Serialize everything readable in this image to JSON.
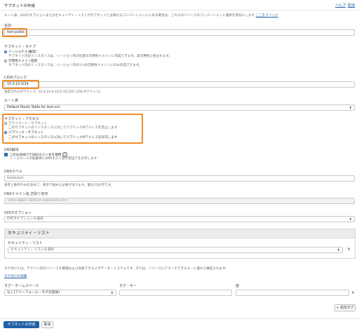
{
  "header": {
    "title": "サブネットの作成",
    "help": "ヘルプ",
    "cancel": "取消"
  },
  "intro": {
    "text": "ルート表、DHCPオプションまたはセキュリティ・リストがサブネットとは異なるコンパートメントにある場合は、これらのリソースのコンパートメント選択を有効にします",
    "link": "ここをクリック"
  },
  "name": {
    "label": "名前",
    "value": "test-public"
  },
  "subnet_type": {
    "label": "サブネット・タイプ",
    "options": [
      {
        "title": "リージョナル(推奨)",
        "desc": "サブネット内のインスタンスは、リージョン内の任意の可用性ドメインに作成できます。高可用性に役立ちます。",
        "selected": true
      },
      {
        "title": "可用性ドメイン固有",
        "desc": "サブネット内のインスタンスは、リージョン内の1つの可用性ドメインにのみ作成できます。",
        "selected": false
      }
    ]
  },
  "cidr": {
    "label": "CIDRブロック",
    "value": "10.0.10.0/24",
    "hint": "指定されたIPアドレス: 10.0.10.0-10.0.10.255 (256 IPアドレス)"
  },
  "route_table": {
    "label": "ルート表",
    "value": "Default Route Table for test-vcn"
  },
  "access": {
    "label": "サブネット・アクセス",
    "options": [
      {
        "title": "プライベート・サブネット",
        "desc": "このサブネットのインスタンスに対してパブリックIPアドレスを禁止します",
        "selected": false
      },
      {
        "title": "パブリック・サブネット",
        "desc": "このサブネットのインスタンスに対してパブリックIPアドレスを許可します",
        "selected": true
      }
    ]
  },
  "dns": {
    "label": "DNS解決",
    "checkbox_label": "このSUBNETでDNSホスト名を使用",
    "checkbox_desc": "インスタンスの起動時にDNSホスト名の割当てを許可します",
    "checked": true
  },
  "dns_label": {
    "label": "DNSラベル",
    "placeholder": "testpublic",
    "hint": "英字と数字のみを含めて、英字で始める必要があります。最大15文字です。"
  },
  "dns_domain": {
    "label": "DNSドメイン名",
    "readonly": "読取り専用",
    "value": "<dns-label>.testvcn.oraclevcn.com"
  },
  "dhcp": {
    "label": "DHCPオプション",
    "value": "DHCPオプションの選択"
  },
  "security": {
    "title": "セキュリティ・リスト",
    "field_label": "セキュリティ・リスト",
    "placeholder": "セキュリティ・リストの選択"
  },
  "tags": {
    "desc": "タグ付けとは、テナンシ内のリソースを整理および追跡できるメタデータ・システムです。タグは、リソースにアタッチできるキーと値から構成されます。",
    "link": "タグ付けの詳細",
    "namespace_label": "タグ・ネームスペース",
    "namespace_value": "なし(フリーフォーム・タグの追加)",
    "key_label": "タグ・キー",
    "value_label": "値",
    "add_tag": "+ 追加タグ"
  },
  "footer": {
    "create": "サブネットの作成",
    "cancel": "取消"
  }
}
